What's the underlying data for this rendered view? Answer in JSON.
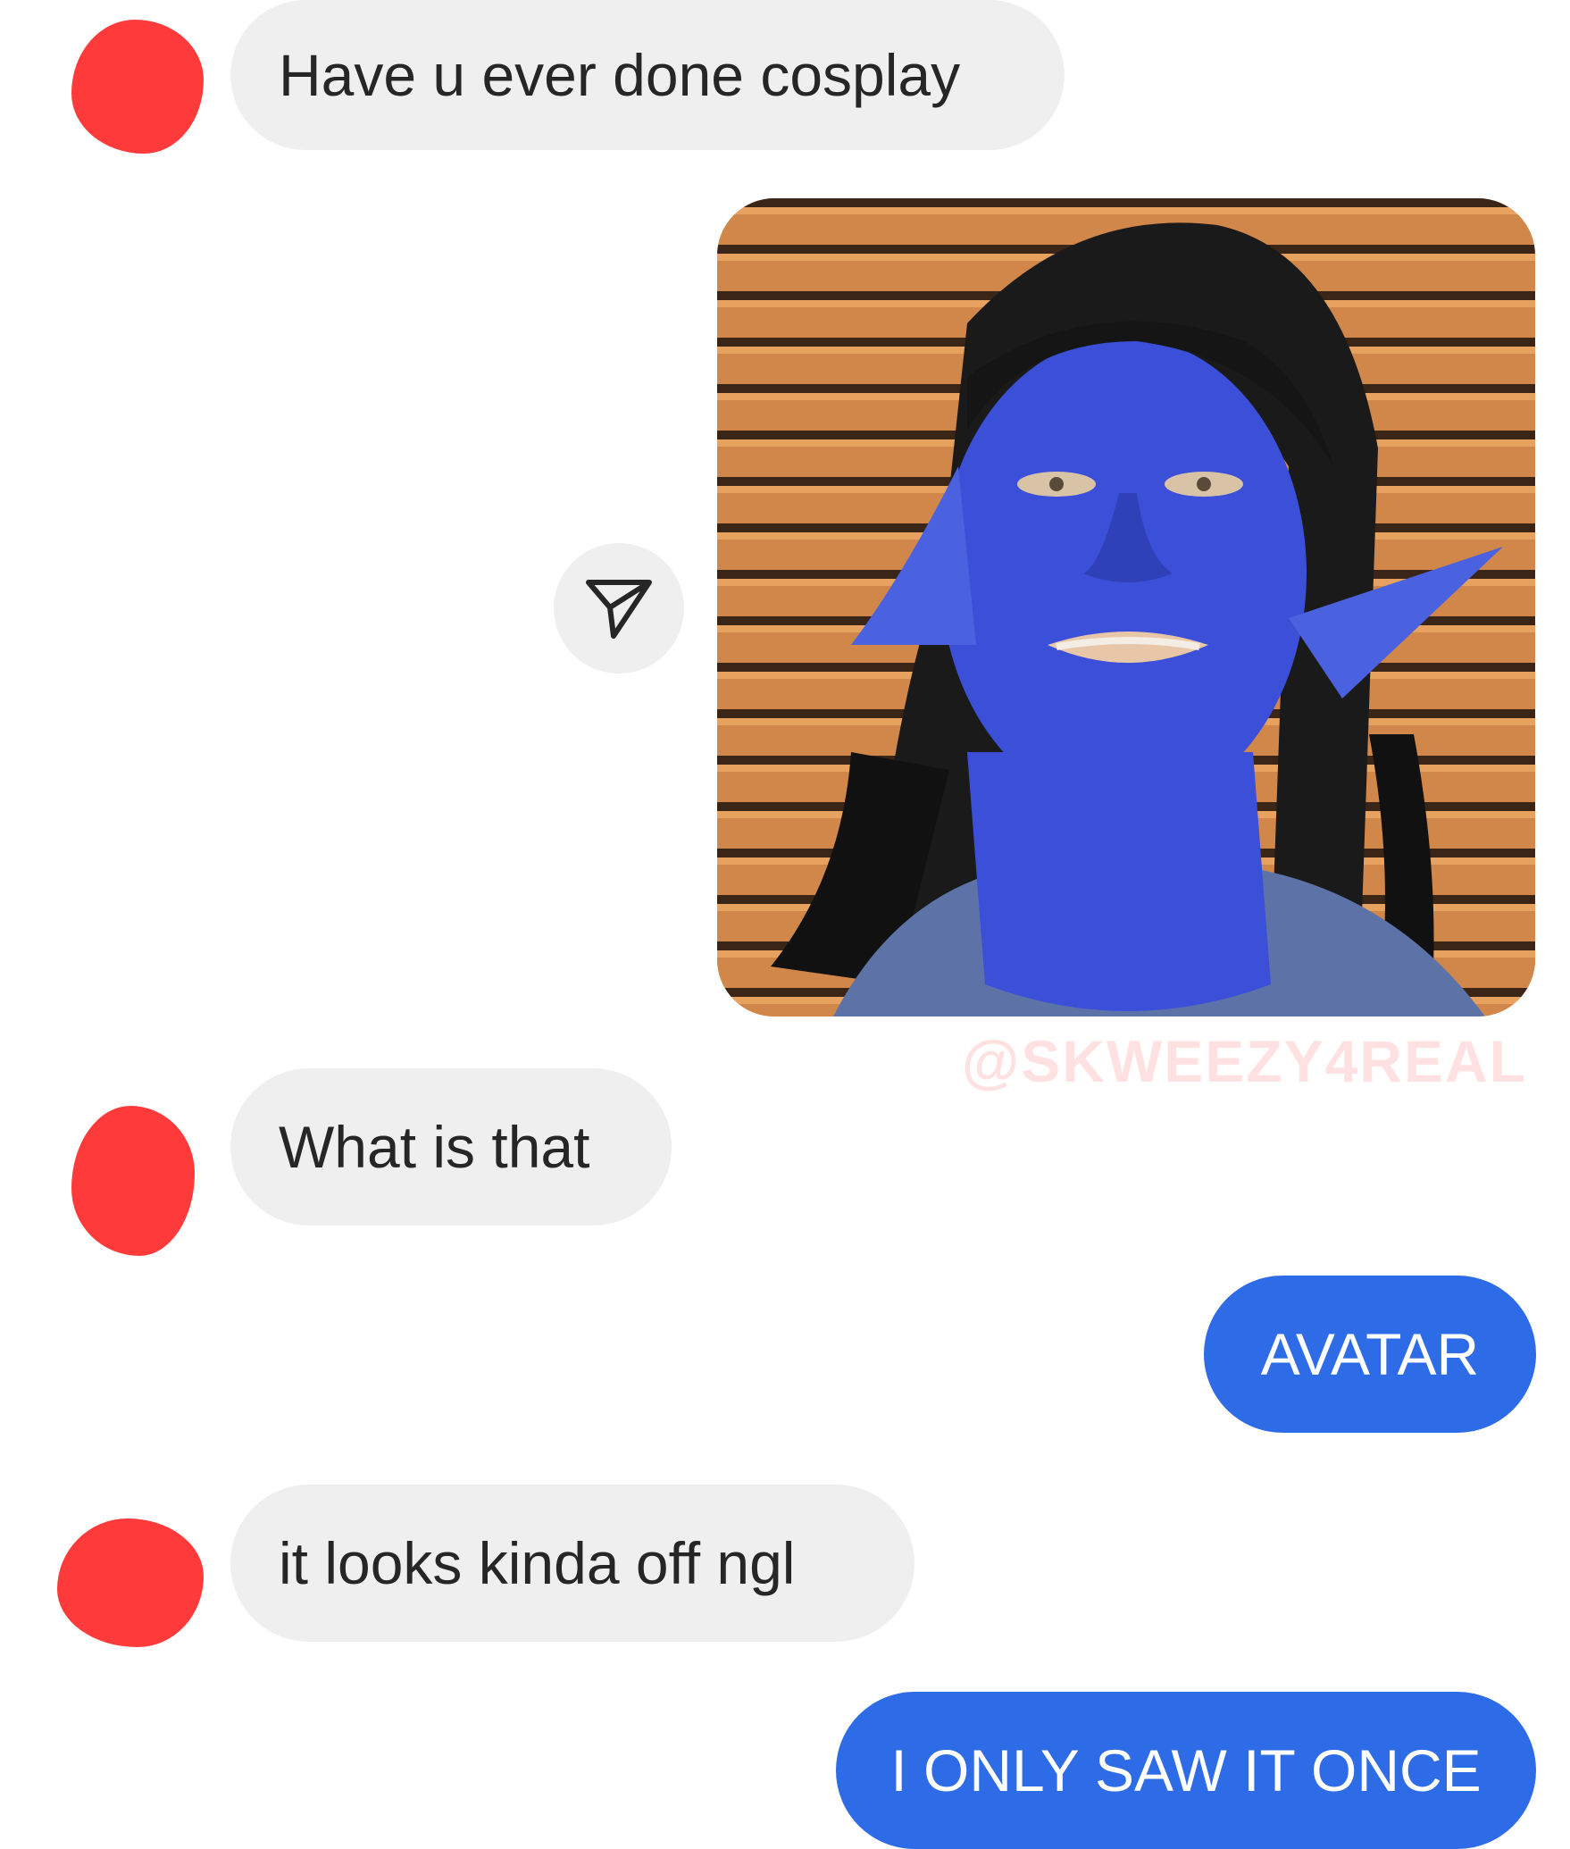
{
  "messages": [
    {
      "sender": "them",
      "text": "Have u ever done cosplay"
    },
    {
      "sender": "me",
      "type": "image",
      "description_icon": "share-icon",
      "watermark": "@SKWEEZY4REAL"
    },
    {
      "sender": "them",
      "text": "What is that"
    },
    {
      "sender": "me",
      "text": "AVATAR"
    },
    {
      "sender": "them",
      "text": "it looks kinda off ngl"
    },
    {
      "sender": "me",
      "text": "I ONLY SAW IT ONCE"
    }
  ],
  "colors": {
    "incoming_bubble": "#efefef",
    "outgoing_bubble": "#2d6ce6",
    "redaction": "#ff3a3a",
    "photo_background": "#c67a3e",
    "face_paint": "#3b4fd8"
  }
}
